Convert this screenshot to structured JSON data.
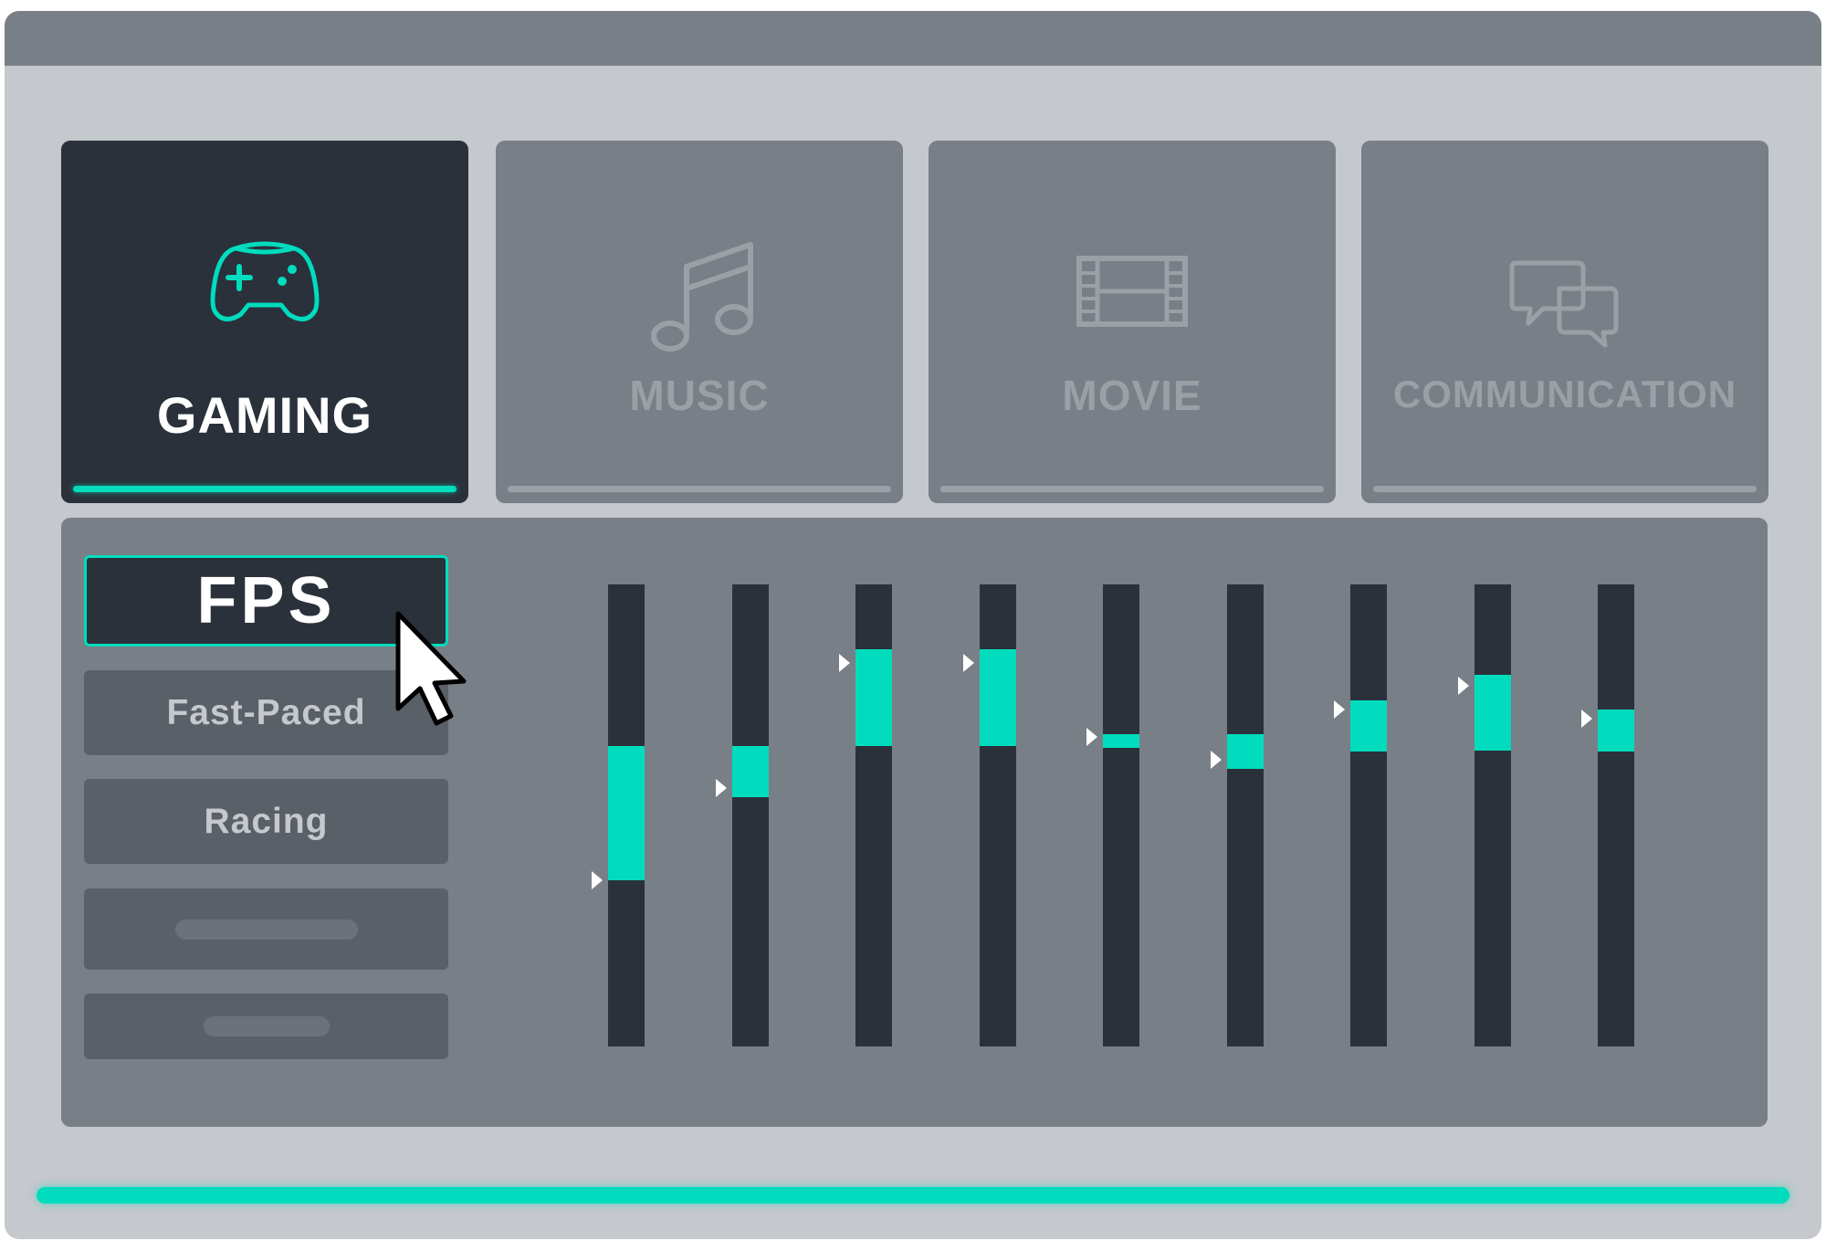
{
  "tabs": [
    {
      "label": "GAMING",
      "icon": "gamepad-icon",
      "active": true
    },
    {
      "label": "MUSIC",
      "icon": "music-note-icon",
      "active": false
    },
    {
      "label": "MOVIE",
      "icon": "film-strip-icon",
      "active": false
    },
    {
      "label": "COMMUNICATION",
      "icon": "chat-bubbles-icon",
      "active": false
    }
  ],
  "presets": [
    {
      "label": "FPS",
      "selected": true
    },
    {
      "label": "Fast-Paced",
      "selected": false
    },
    {
      "label": "Racing",
      "selected": false
    },
    {
      "label": "",
      "selected": false
    },
    {
      "label": "",
      "selected": false
    }
  ],
  "equalizer": {
    "band_count": 9,
    "bands": [
      {
        "fill_top": 0.35,
        "fill_bottom": 0.64,
        "marker": 0.64
      },
      {
        "fill_top": 0.35,
        "fill_bottom": 0.46,
        "marker": 0.44
      },
      {
        "fill_top": 0.14,
        "fill_bottom": 0.35,
        "marker": 0.17
      },
      {
        "fill_top": 0.14,
        "fill_bottom": 0.35,
        "marker": 0.17
      },
      {
        "fill_top": 0.325,
        "fill_bottom": 0.355,
        "marker": 0.33
      },
      {
        "fill_top": 0.325,
        "fill_bottom": 0.4,
        "marker": 0.38
      },
      {
        "fill_top": 0.25,
        "fill_bottom": 0.36,
        "marker": 0.27
      },
      {
        "fill_top": 0.195,
        "fill_bottom": 0.36,
        "marker": 0.22
      },
      {
        "fill_top": 0.27,
        "fill_bottom": 0.36,
        "marker": 0.29
      }
    ]
  },
  "progress": {
    "value": 1.0
  },
  "colors": {
    "accent": "#00dcbd",
    "dark": "#2a313a",
    "panel": "#787f86",
    "window": "#c5c8cc"
  }
}
